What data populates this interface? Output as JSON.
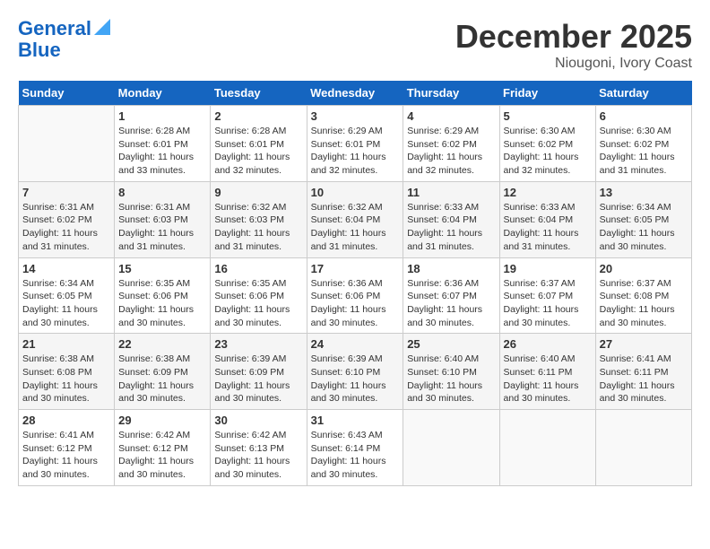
{
  "header": {
    "logo_line1": "General",
    "logo_line2": "Blue",
    "month_title": "December 2025",
    "location": "Niougoni, Ivory Coast"
  },
  "days_of_week": [
    "Sunday",
    "Monday",
    "Tuesday",
    "Wednesday",
    "Thursday",
    "Friday",
    "Saturday"
  ],
  "weeks": [
    [
      {
        "day": "",
        "sunrise": "",
        "sunset": "",
        "daylight": ""
      },
      {
        "day": "1",
        "sunrise": "Sunrise: 6:28 AM",
        "sunset": "Sunset: 6:01 PM",
        "daylight": "Daylight: 11 hours and 33 minutes."
      },
      {
        "day": "2",
        "sunrise": "Sunrise: 6:28 AM",
        "sunset": "Sunset: 6:01 PM",
        "daylight": "Daylight: 11 hours and 32 minutes."
      },
      {
        "day": "3",
        "sunrise": "Sunrise: 6:29 AM",
        "sunset": "Sunset: 6:01 PM",
        "daylight": "Daylight: 11 hours and 32 minutes."
      },
      {
        "day": "4",
        "sunrise": "Sunrise: 6:29 AM",
        "sunset": "Sunset: 6:02 PM",
        "daylight": "Daylight: 11 hours and 32 minutes."
      },
      {
        "day": "5",
        "sunrise": "Sunrise: 6:30 AM",
        "sunset": "Sunset: 6:02 PM",
        "daylight": "Daylight: 11 hours and 32 minutes."
      },
      {
        "day": "6",
        "sunrise": "Sunrise: 6:30 AM",
        "sunset": "Sunset: 6:02 PM",
        "daylight": "Daylight: 11 hours and 31 minutes."
      }
    ],
    [
      {
        "day": "7",
        "sunrise": "Sunrise: 6:31 AM",
        "sunset": "Sunset: 6:02 PM",
        "daylight": "Daylight: 11 hours and 31 minutes."
      },
      {
        "day": "8",
        "sunrise": "Sunrise: 6:31 AM",
        "sunset": "Sunset: 6:03 PM",
        "daylight": "Daylight: 11 hours and 31 minutes."
      },
      {
        "day": "9",
        "sunrise": "Sunrise: 6:32 AM",
        "sunset": "Sunset: 6:03 PM",
        "daylight": "Daylight: 11 hours and 31 minutes."
      },
      {
        "day": "10",
        "sunrise": "Sunrise: 6:32 AM",
        "sunset": "Sunset: 6:04 PM",
        "daylight": "Daylight: 11 hours and 31 minutes."
      },
      {
        "day": "11",
        "sunrise": "Sunrise: 6:33 AM",
        "sunset": "Sunset: 6:04 PM",
        "daylight": "Daylight: 11 hours and 31 minutes."
      },
      {
        "day": "12",
        "sunrise": "Sunrise: 6:33 AM",
        "sunset": "Sunset: 6:04 PM",
        "daylight": "Daylight: 11 hours and 31 minutes."
      },
      {
        "day": "13",
        "sunrise": "Sunrise: 6:34 AM",
        "sunset": "Sunset: 6:05 PM",
        "daylight": "Daylight: 11 hours and 30 minutes."
      }
    ],
    [
      {
        "day": "14",
        "sunrise": "Sunrise: 6:34 AM",
        "sunset": "Sunset: 6:05 PM",
        "daylight": "Daylight: 11 hours and 30 minutes."
      },
      {
        "day": "15",
        "sunrise": "Sunrise: 6:35 AM",
        "sunset": "Sunset: 6:06 PM",
        "daylight": "Daylight: 11 hours and 30 minutes."
      },
      {
        "day": "16",
        "sunrise": "Sunrise: 6:35 AM",
        "sunset": "Sunset: 6:06 PM",
        "daylight": "Daylight: 11 hours and 30 minutes."
      },
      {
        "day": "17",
        "sunrise": "Sunrise: 6:36 AM",
        "sunset": "Sunset: 6:06 PM",
        "daylight": "Daylight: 11 hours and 30 minutes."
      },
      {
        "day": "18",
        "sunrise": "Sunrise: 6:36 AM",
        "sunset": "Sunset: 6:07 PM",
        "daylight": "Daylight: 11 hours and 30 minutes."
      },
      {
        "day": "19",
        "sunrise": "Sunrise: 6:37 AM",
        "sunset": "Sunset: 6:07 PM",
        "daylight": "Daylight: 11 hours and 30 minutes."
      },
      {
        "day": "20",
        "sunrise": "Sunrise: 6:37 AM",
        "sunset": "Sunset: 6:08 PM",
        "daylight": "Daylight: 11 hours and 30 minutes."
      }
    ],
    [
      {
        "day": "21",
        "sunrise": "Sunrise: 6:38 AM",
        "sunset": "Sunset: 6:08 PM",
        "daylight": "Daylight: 11 hours and 30 minutes."
      },
      {
        "day": "22",
        "sunrise": "Sunrise: 6:38 AM",
        "sunset": "Sunset: 6:09 PM",
        "daylight": "Daylight: 11 hours and 30 minutes."
      },
      {
        "day": "23",
        "sunrise": "Sunrise: 6:39 AM",
        "sunset": "Sunset: 6:09 PM",
        "daylight": "Daylight: 11 hours and 30 minutes."
      },
      {
        "day": "24",
        "sunrise": "Sunrise: 6:39 AM",
        "sunset": "Sunset: 6:10 PM",
        "daylight": "Daylight: 11 hours and 30 minutes."
      },
      {
        "day": "25",
        "sunrise": "Sunrise: 6:40 AM",
        "sunset": "Sunset: 6:10 PM",
        "daylight": "Daylight: 11 hours and 30 minutes."
      },
      {
        "day": "26",
        "sunrise": "Sunrise: 6:40 AM",
        "sunset": "Sunset: 6:11 PM",
        "daylight": "Daylight: 11 hours and 30 minutes."
      },
      {
        "day": "27",
        "sunrise": "Sunrise: 6:41 AM",
        "sunset": "Sunset: 6:11 PM",
        "daylight": "Daylight: 11 hours and 30 minutes."
      }
    ],
    [
      {
        "day": "28",
        "sunrise": "Sunrise: 6:41 AM",
        "sunset": "Sunset: 6:12 PM",
        "daylight": "Daylight: 11 hours and 30 minutes."
      },
      {
        "day": "29",
        "sunrise": "Sunrise: 6:42 AM",
        "sunset": "Sunset: 6:12 PM",
        "daylight": "Daylight: 11 hours and 30 minutes."
      },
      {
        "day": "30",
        "sunrise": "Sunrise: 6:42 AM",
        "sunset": "Sunset: 6:13 PM",
        "daylight": "Daylight: 11 hours and 30 minutes."
      },
      {
        "day": "31",
        "sunrise": "Sunrise: 6:43 AM",
        "sunset": "Sunset: 6:14 PM",
        "daylight": "Daylight: 11 hours and 30 minutes."
      },
      {
        "day": "",
        "sunrise": "",
        "sunset": "",
        "daylight": ""
      },
      {
        "day": "",
        "sunrise": "",
        "sunset": "",
        "daylight": ""
      },
      {
        "day": "",
        "sunrise": "",
        "sunset": "",
        "daylight": ""
      }
    ]
  ]
}
